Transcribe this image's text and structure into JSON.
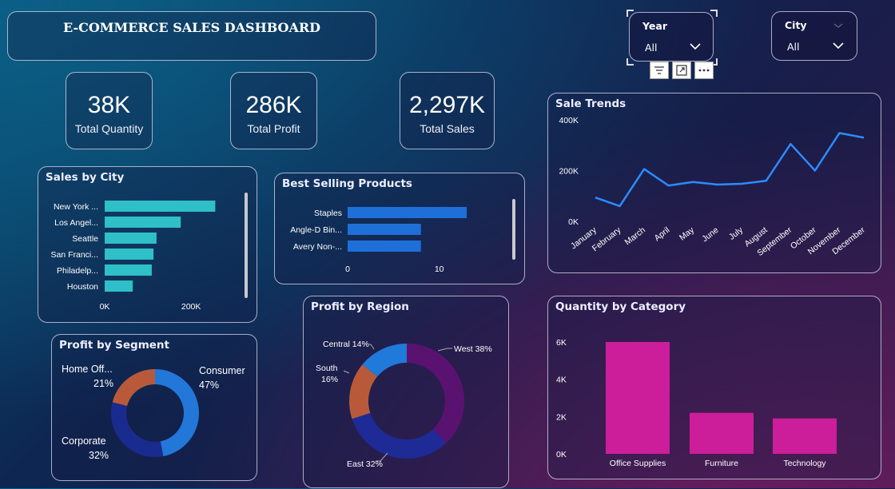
{
  "header": {
    "title": "E-COMMERCE SALES DASHBOARD"
  },
  "slicers": {
    "year": {
      "label": "Year",
      "value": "All"
    },
    "city": {
      "label": "City",
      "value": "All"
    }
  },
  "kpis": [
    {
      "value": "38K",
      "label": "Total Quantity"
    },
    {
      "value": "286K",
      "label": "Total Profit"
    },
    {
      "value": "2,297K",
      "label": "Total Sales"
    }
  ],
  "colors": {
    "city_bar": "#2fbfc8",
    "product_bar": "#1f6fd9",
    "trend_line": "#2b8cff",
    "category_bar": "#cc1e9a",
    "segment": [
      "#2277d9",
      "#1a2b8f",
      "#b85a3a"
    ],
    "region": [
      "#5a1270",
      "#1e2a96",
      "#b85a3a",
      "#1f7ad9"
    ]
  },
  "chart_data": [
    {
      "id": "sales_by_city",
      "type": "bar",
      "orientation": "horizontal",
      "title": "Sales by City",
      "categories": [
        "New York ...",
        "Los Angel...",
        "Seattle",
        "San Franci...",
        "Philadelp...",
        "Houston"
      ],
      "values": [
        256000,
        176000,
        120000,
        113000,
        109000,
        65000
      ],
      "xticks": [
        "0K",
        "200K"
      ],
      "xlim": [
        0,
        320000
      ]
    },
    {
      "id": "best_selling_products",
      "type": "bar",
      "orientation": "horizontal",
      "title": "Best Selling Products",
      "categories": [
        "Staples",
        "Angle-D Bin...",
        "Avery Non-..."
      ],
      "values": [
        13,
        8,
        8
      ],
      "xticks": [
        "0",
        "10"
      ],
      "xlim": [
        0,
        15
      ]
    },
    {
      "id": "sale_trends",
      "type": "line",
      "title": "Sale Trends",
      "x": [
        "January",
        "February",
        "March",
        "April",
        "May",
        "June",
        "July",
        "August",
        "September",
        "October",
        "November",
        "December"
      ],
      "values": [
        94000,
        60000,
        206000,
        141000,
        155000,
        145000,
        148000,
        160000,
        305000,
        200000,
        348000,
        330000
      ],
      "yticks": [
        "0K",
        "200K",
        "400K"
      ],
      "ylim": [
        0,
        400000
      ]
    },
    {
      "id": "profit_by_segment",
      "type": "pie",
      "donut": true,
      "title": "Profit by Segment",
      "categories": [
        "Consumer",
        "Corporate",
        "Home Off..."
      ],
      "values": [
        47,
        32,
        21
      ],
      "labels": [
        "47%",
        "32%",
        "21%"
      ]
    },
    {
      "id": "profit_by_region",
      "type": "pie",
      "donut": true,
      "title": "Profit by Region",
      "categories": [
        "West",
        "East",
        "South",
        "Central"
      ],
      "values": [
        38,
        32,
        16,
        14
      ],
      "labels": [
        "West 38%",
        "East 32%",
        "South",
        "Central 14%"
      ],
      "south_pct": "16%"
    },
    {
      "id": "quantity_by_category",
      "type": "bar",
      "title": "Quantity by Category",
      "categories": [
        "Office Supplies",
        "Furniture",
        "Technology"
      ],
      "values": [
        6000,
        2200,
        1900
      ],
      "yticks": [
        "0K",
        "2K",
        "4K",
        "6K"
      ],
      "ylim": [
        0,
        6000
      ]
    }
  ]
}
